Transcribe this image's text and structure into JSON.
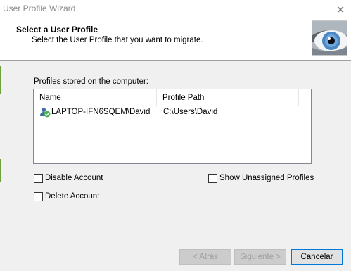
{
  "window": {
    "title": "User Profile Wizard",
    "close_glyph": "✕"
  },
  "header": {
    "title": "Select a User Profile",
    "subtitle": "Select the User Profile that you want to migrate.",
    "image_icon": "eye-image"
  },
  "profiles": {
    "label": "Profiles stored on the computer:",
    "columns": [
      "Name",
      "Profile Path"
    ],
    "rows": [
      {
        "name": "LAPTOP-IFN6SQEM\\David",
        "path": "C:\\Users\\David",
        "icon": "user-icon"
      }
    ]
  },
  "options": {
    "disable_account": {
      "label": "Disable Account",
      "checked": false
    },
    "delete_account": {
      "label": "Delete Account",
      "checked": false
    },
    "show_unassigned": {
      "label": "Show Unassigned Profiles",
      "checked": false
    }
  },
  "buttons": {
    "back": "< Atrás",
    "next": "Siguiente >",
    "cancel": "Cancelar"
  },
  "colors": {
    "accent_border": "#0078d7",
    "disabled_text": "#a0a0a0"
  }
}
